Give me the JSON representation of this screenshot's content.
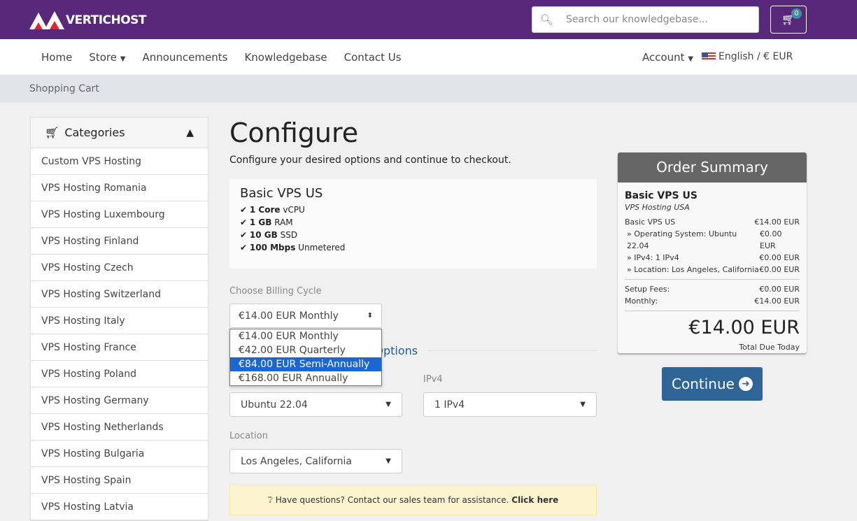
{
  "header": {
    "logo": "VERTICHOST",
    "search_placeholder": "Search our knowledgebase...",
    "cart_count": "0"
  },
  "nav": {
    "items": [
      "Home",
      "Store",
      "Announcements",
      "Knowledgebase",
      "Contact Us"
    ],
    "account": "Account",
    "language": "English / € EUR"
  },
  "breadcrumb": "Shopping Cart",
  "sidebar": {
    "title": "Categories",
    "items": [
      "Custom VPS Hosting",
      "VPS Hosting Romania",
      "VPS Hosting Luxembourg",
      "VPS Hosting Finland",
      "VPS Hosting Czech",
      "VPS Hosting Switzerland",
      "VPS Hosting Italy",
      "VPS Hosting France",
      "VPS Hosting Poland",
      "VPS Hosting Germany",
      "VPS Hosting Netherlands",
      "VPS Hosting Bulgaria",
      "VPS Hosting Spain",
      "VPS Hosting Latvia"
    ]
  },
  "main": {
    "title": "Configure",
    "subtitle": "Configure your desired options and continue to checkout.",
    "product": {
      "name": "Basic VPS US",
      "features": [
        [
          "1 Core",
          "vCPU"
        ],
        [
          "1 GB",
          "RAM"
        ],
        [
          "10 GB",
          "SSD"
        ],
        [
          "100 Mbps",
          "Unmetered"
        ]
      ]
    },
    "billing_label": "Choose Billing Cycle",
    "billing_value": "€14.00 EUR Monthly",
    "billing_options": [
      "€14.00 EUR Monthly",
      "€42.00 EUR Quarterly",
      "€84.00 EUR Semi-Annually",
      "€168.00 EUR Annually"
    ],
    "highlighted_option": 2,
    "config_heading": "Configurable Options",
    "os_value": "Ubuntu 22.04",
    "ipv4_label": "IPv4",
    "ipv4_value": "1 IPv4",
    "location_label": "Location",
    "location_value": "Los Angeles, California",
    "help_text": "Have questions? Contact our sales team for assistance.",
    "help_link": "Click here"
  },
  "summary": {
    "title": "Order Summary",
    "product": "Basic VPS US",
    "group": "VPS Hosting USA",
    "lines": [
      [
        "Basic VPS US",
        "€14.00 EUR"
      ],
      [
        "» Operating System: Ubuntu 22.04",
        "€0.00 EUR"
      ],
      [
        "» IPv4: 1 IPv4",
        "€0.00 EUR"
      ],
      [
        "» Location: Los Angeles, California",
        "€0.00 EUR"
      ]
    ],
    "setup_label": "Setup Fees:",
    "setup": "€0.00 EUR",
    "monthly_label": "Monthly:",
    "monthly": "€14.00 EUR",
    "total": "€14.00 EUR",
    "total_label": "Total Due Today"
  },
  "continue_label": "Continue"
}
